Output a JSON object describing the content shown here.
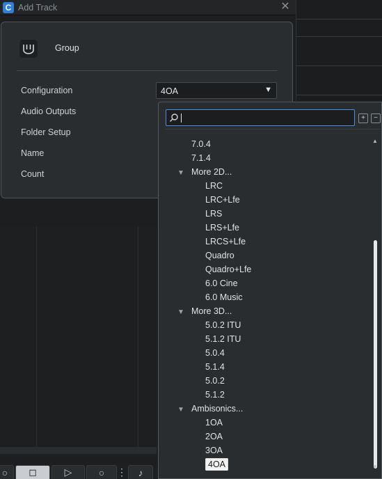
{
  "window": {
    "title": "Add Track",
    "close_glyph": "✕"
  },
  "panel": {
    "title": "Group",
    "icon": "group-track-icon",
    "fields": {
      "configuration": "Configuration",
      "audio_outputs": "Audio Outputs",
      "folder_setup": "Folder Setup",
      "name": "Name",
      "count": "Count"
    },
    "configuration_value": "4OA",
    "dropdown_arrow": "▼"
  },
  "popup": {
    "search": {
      "value": "",
      "placeholder": ""
    },
    "items": [
      {
        "label": "7.0.4",
        "level": 1
      },
      {
        "label": "7.1.4",
        "level": 1
      },
      {
        "label": "More 2D...",
        "level": 0,
        "expanded": true
      },
      {
        "label": "LRC",
        "level": 2
      },
      {
        "label": "LRC+Lfe",
        "level": 2
      },
      {
        "label": "LRS",
        "level": 2
      },
      {
        "label": "LRS+Lfe",
        "level": 2
      },
      {
        "label": "LRCS+Lfe",
        "level": 2
      },
      {
        "label": "Quadro",
        "level": 2
      },
      {
        "label": "Quadro+Lfe",
        "level": 2
      },
      {
        "label": "6.0 Cine",
        "level": 2
      },
      {
        "label": "6.0 Music",
        "level": 2
      },
      {
        "label": "More 3D...",
        "level": 0,
        "expanded": true
      },
      {
        "label": "5.0.2 ITU",
        "level": 2
      },
      {
        "label": "5.1.2 ITU",
        "level": 2
      },
      {
        "label": "5.0.4",
        "level": 2
      },
      {
        "label": "5.1.4",
        "level": 2
      },
      {
        "label": "5.0.2",
        "level": 2
      },
      {
        "label": "5.1.2",
        "level": 2
      },
      {
        "label": "Ambisonics...",
        "level": 0,
        "expanded": true
      },
      {
        "label": "1OA",
        "level": 2
      },
      {
        "label": "2OA",
        "level": 2
      },
      {
        "label": "3OA",
        "level": 2
      },
      {
        "label": "4OA",
        "level": 2,
        "selected": true
      }
    ]
  },
  "colors": {
    "accent": "#4a8fe0",
    "selection_bg": "#f2f2f2"
  }
}
